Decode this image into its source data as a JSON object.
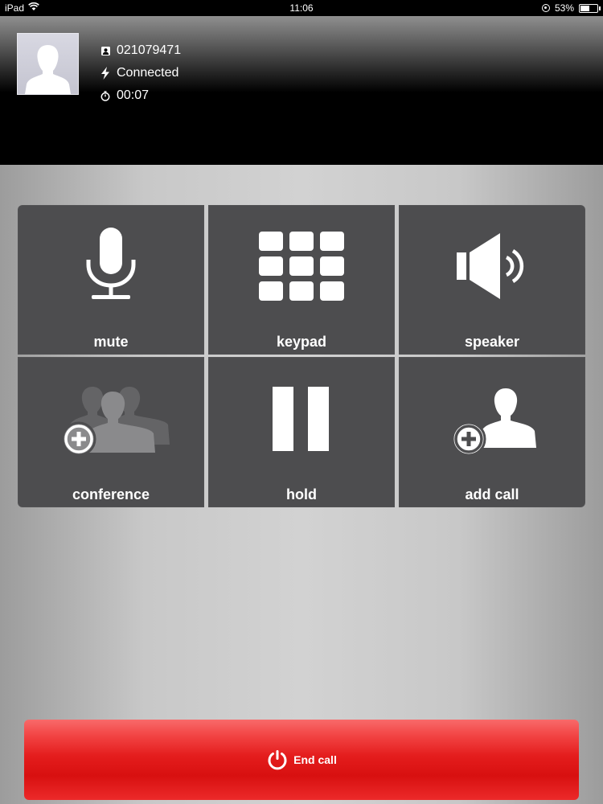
{
  "status_bar": {
    "device": "iPad",
    "time": "11:06",
    "battery": "53%",
    "battery_level": 0.53
  },
  "caller": {
    "number": "021079471",
    "status": "Connected",
    "duration": "00:07",
    "icons": [
      "contact-card-icon",
      "lightning-icon",
      "stopwatch-icon"
    ]
  },
  "controls": [
    {
      "label": "mute",
      "icon": "microphone-icon"
    },
    {
      "label": "keypad",
      "icon": "keypad-icon"
    },
    {
      "label": "speaker",
      "icon": "speaker-icon"
    },
    {
      "label": "conference",
      "icon": "conference-icon"
    },
    {
      "label": "hold",
      "icon": "pause-icon"
    },
    {
      "label": "add call",
      "icon": "add-person-icon"
    }
  ],
  "end_call": {
    "label": "End call",
    "icon": "power-icon"
  },
  "colors": {
    "tile": "#4d4d4f",
    "end_call": "#e41d1d",
    "header": "#000000"
  }
}
